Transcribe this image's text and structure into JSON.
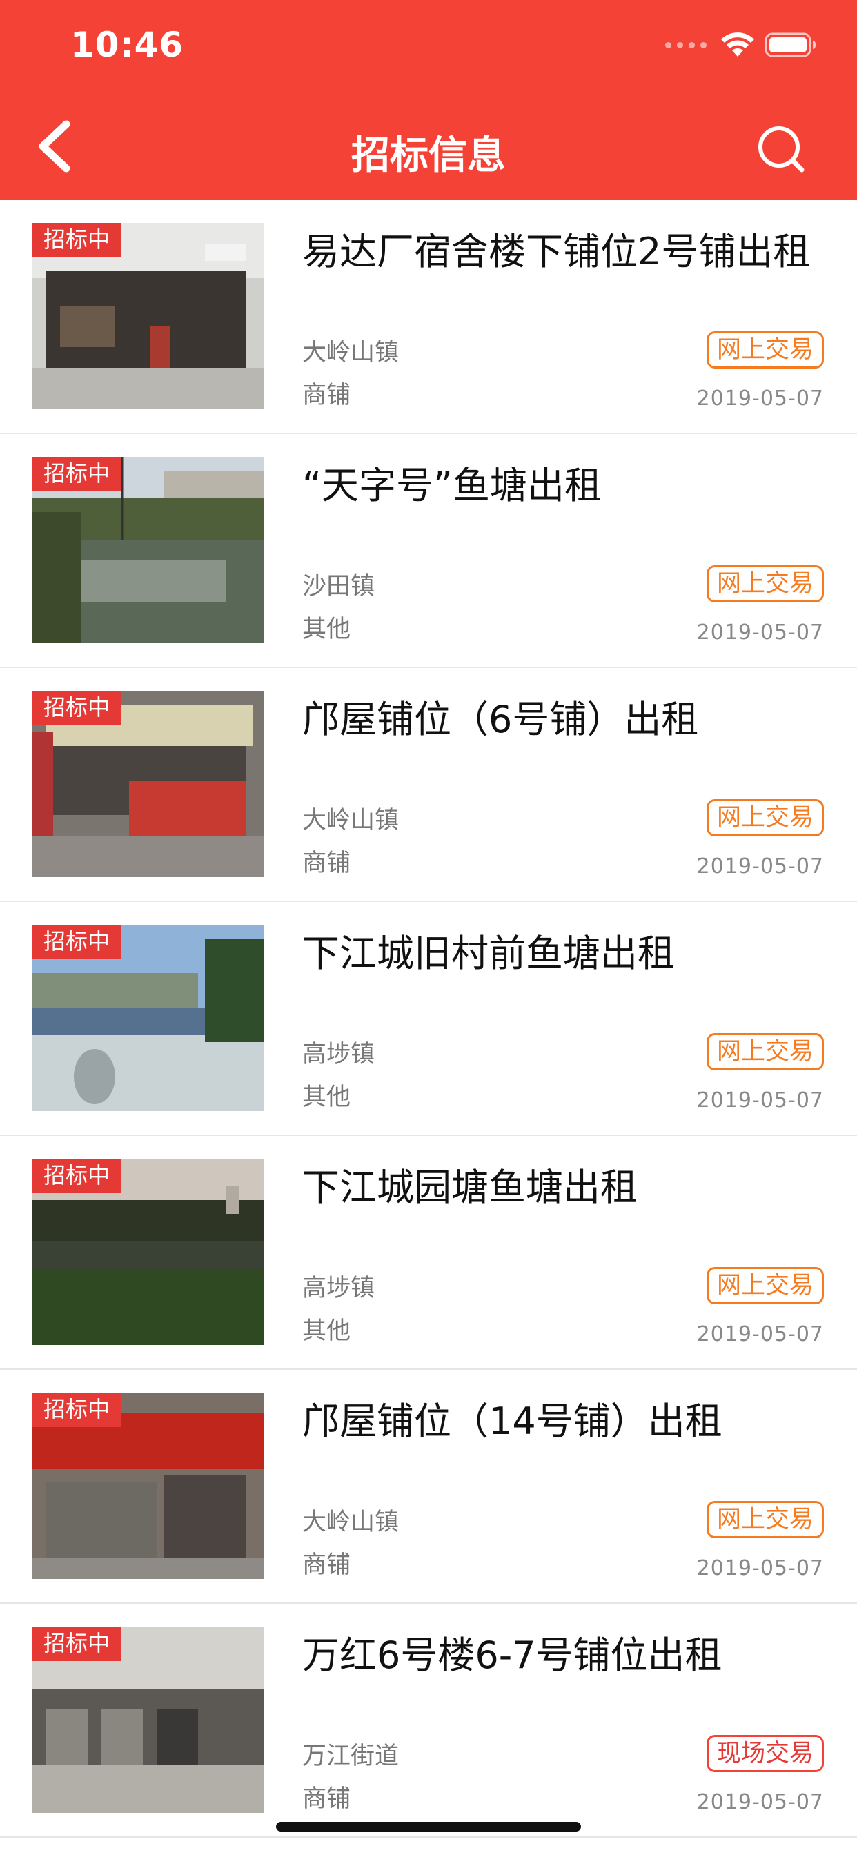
{
  "status_bar": {
    "time": "10:46"
  },
  "nav": {
    "title": "招标信息",
    "back_icon": "chevron-left-icon",
    "search_icon": "search-icon"
  },
  "colors": {
    "header_bg": "#f44336",
    "badge_bg": "#e53935",
    "online_trade": "#f47b20",
    "onsite_trade": "#e53935"
  },
  "items": [
    {
      "status": "招标中",
      "title": "易达厂宿舍楼下铺位2号铺出租",
      "town": "大岭山镇",
      "type": "商铺",
      "trade": "网上交易",
      "date": "2019-05-07"
    },
    {
      "status": "招标中",
      "title": "“天字号”鱼塘出租",
      "town": "沙田镇",
      "type": "其他",
      "trade": "网上交易",
      "date": "2019-05-07"
    },
    {
      "status": "招标中",
      "title": "邝屋铺位（6号铺）出租",
      "town": "大岭山镇",
      "type": "商铺",
      "trade": "网上交易",
      "date": "2019-05-07"
    },
    {
      "status": "招标中",
      "title": "下江城旧村前鱼塘出租",
      "town": "高埗镇",
      "type": "其他",
      "trade": "网上交易",
      "date": "2019-05-07"
    },
    {
      "status": "招标中",
      "title": "下江城园塘鱼塘出租",
      "town": "高埗镇",
      "type": "其他",
      "trade": "网上交易",
      "date": "2019-05-07"
    },
    {
      "status": "招标中",
      "title": "邝屋铺位（14号铺）出租",
      "town": "大岭山镇",
      "type": "商铺",
      "trade": "网上交易",
      "date": "2019-05-07"
    },
    {
      "status": "招标中",
      "title": "万红6号楼6-7号铺位出租",
      "town": "万江街道",
      "type": "商铺",
      "trade": "现场交易",
      "date": "2019-05-07"
    }
  ]
}
